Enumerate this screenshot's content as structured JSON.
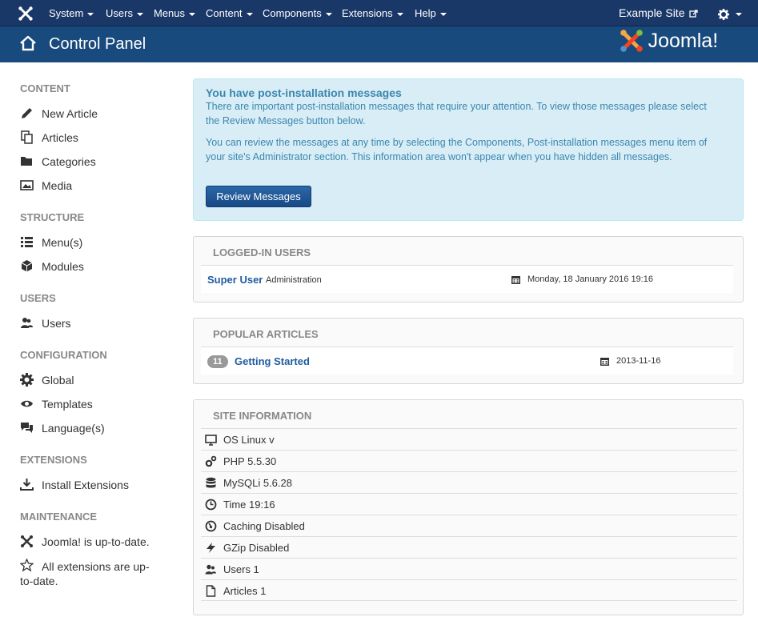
{
  "topnav": {
    "menus": [
      "System",
      "Users",
      "Menus",
      "Content",
      "Components",
      "Extensions",
      "Help"
    ],
    "site_link": "Example Site"
  },
  "header": {
    "title": "Control Panel",
    "brand": "Joomla!"
  },
  "sidebar": {
    "sections": [
      {
        "title": "CONTENT",
        "items": [
          {
            "label": "New Article",
            "icon": "pencil-icon"
          },
          {
            "label": "Articles",
            "icon": "copy-icon"
          },
          {
            "label": "Categories",
            "icon": "folder-icon"
          },
          {
            "label": "Media",
            "icon": "image-icon"
          }
        ]
      },
      {
        "title": "STRUCTURE",
        "items": [
          {
            "label": "Menu(s)",
            "icon": "list-icon"
          },
          {
            "label": "Modules",
            "icon": "cube-icon"
          }
        ]
      },
      {
        "title": "USERS",
        "items": [
          {
            "label": "Users",
            "icon": "users-icon"
          }
        ]
      },
      {
        "title": "CONFIGURATION",
        "items": [
          {
            "label": "Global",
            "icon": "cog-icon"
          },
          {
            "label": "Templates",
            "icon": "eye-icon"
          },
          {
            "label": "Language(s)",
            "icon": "comments-icon"
          }
        ]
      },
      {
        "title": "EXTENSIONS",
        "items": [
          {
            "label": "Install Extensions",
            "icon": "download-icon"
          }
        ]
      },
      {
        "title": "MAINTENANCE",
        "items": [
          {
            "label": "Joomla! is up-to-date.",
            "icon": "joomla-icon"
          },
          {
            "label": "All extensions are up-to-date.",
            "icon": "star-icon"
          }
        ]
      }
    ]
  },
  "alert": {
    "heading": "You have post-installation messages",
    "para1": "There are important post-installation messages that require your attention. To view those messages please select the Review Messages button below.",
    "para2": "You can review the messages at any time by selecting the Components, Post-installation messages menu item of your site's Administrator section. This information area won't appear when you have hidden all messages.",
    "button": "Review Messages"
  },
  "logged_in": {
    "heading": "LOGGED-IN USERS",
    "rows": [
      {
        "name": "Super User",
        "role": "Administration",
        "date": "Monday, 18 January 2016 19:16"
      }
    ]
  },
  "popular": {
    "heading": "POPULAR ARTICLES",
    "rows": [
      {
        "hits": "11",
        "title": "Getting Started",
        "date": "2013-11-16"
      }
    ]
  },
  "site_info": {
    "heading": "SITE INFORMATION",
    "rows": [
      {
        "label": "OS Linux v",
        "icon": "desktop-icon"
      },
      {
        "label": "PHP 5.5.30",
        "icon": "cogs-icon"
      },
      {
        "label": "MySQLi 5.6.28",
        "icon": "database-icon"
      },
      {
        "label": "Time 19:16",
        "icon": "clock-icon"
      },
      {
        "label": "Caching Disabled",
        "icon": "dashboard-icon"
      },
      {
        "label": "GZip Disabled",
        "icon": "flash-icon"
      },
      {
        "label": "Users 1",
        "icon": "users-icon"
      },
      {
        "label": "Articles 1",
        "icon": "file-icon"
      }
    ]
  },
  "colors": {
    "topbar": "#1a3867",
    "header": "#184a7d",
    "alert_bg": "#d9edf7",
    "link": "#1f5c9e"
  }
}
